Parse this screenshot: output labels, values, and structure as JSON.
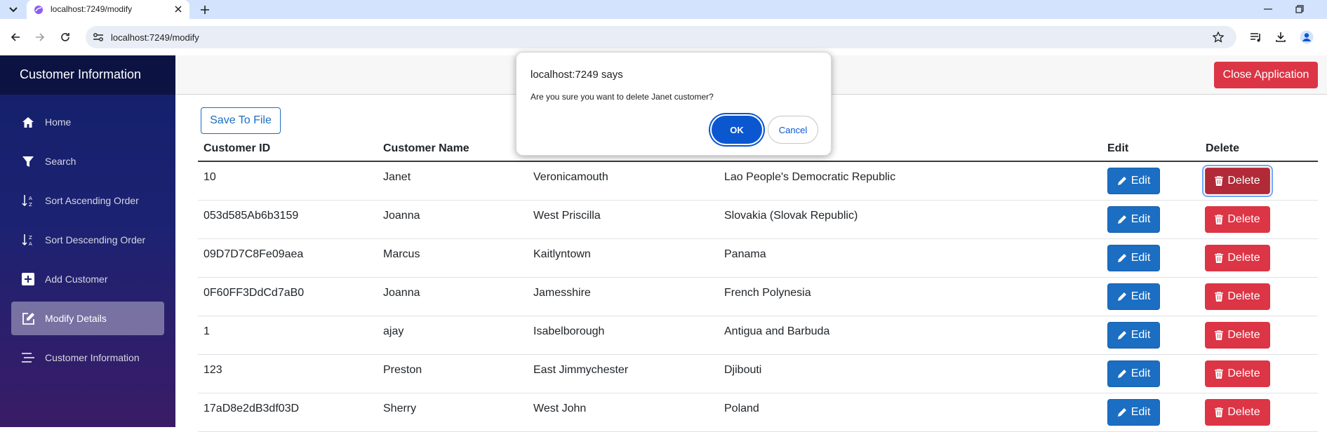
{
  "browser": {
    "tab_title": "localhost:7249/modify",
    "url": "localhost:7249/modify"
  },
  "sidebar": {
    "title": "Customer Information",
    "items": [
      {
        "label": "Home",
        "icon": "home-icon"
      },
      {
        "label": "Search",
        "icon": "filter-icon"
      },
      {
        "label": "Sort Ascending Order",
        "icon": "sort-ascending-icon"
      },
      {
        "label": "Sort Descending Order",
        "icon": "sort-descending-icon"
      },
      {
        "label": "Add Customer",
        "icon": "plus-square-icon"
      },
      {
        "label": "Modify Details",
        "icon": "edit-square-icon",
        "active": true
      },
      {
        "label": "Customer Information",
        "icon": "list-icon"
      }
    ]
  },
  "topbar": {
    "close_label": "Close Application"
  },
  "main": {
    "save_label": "Save To File",
    "columns": [
      "Customer ID",
      "Customer Name",
      "",
      "",
      "Edit",
      "Delete"
    ],
    "rows": [
      {
        "id": "10",
        "name": "Janet",
        "city": "Veronicamouth",
        "country": "Lao People's Democratic Republic"
      },
      {
        "id": "053d585Ab6b3159",
        "name": "Joanna",
        "city": "West Priscilla",
        "country": "Slovakia (Slovak Republic)"
      },
      {
        "id": "09D7D7C8Fe09aea",
        "name": "Marcus",
        "city": "Kaitlyntown",
        "country": "Panama"
      },
      {
        "id": "0F60FF3DdCd7aB0",
        "name": "Joanna",
        "city": "Jamesshire",
        "country": "French Polynesia"
      },
      {
        "id": "1",
        "name": "ajay",
        "city": "Isabelborough",
        "country": "Antigua and Barbuda"
      },
      {
        "id": "123",
        "name": "Preston",
        "city": "East Jimmychester",
        "country": "Djibouti"
      },
      {
        "id": "17aD8e2dB3df03D",
        "name": "Sherry",
        "city": "West John",
        "country": "Poland"
      }
    ],
    "edit_label": "Edit",
    "delete_label": "Delete"
  },
  "dialog": {
    "title": "localhost:7249 says",
    "message": "Are you sure you want to delete Janet customer?",
    "ok_label": "OK",
    "cancel_label": "Cancel"
  },
  "colors": {
    "primary": "#1b6ec2",
    "danger": "#dc3545",
    "dialog_accent": "#0b57d0"
  }
}
